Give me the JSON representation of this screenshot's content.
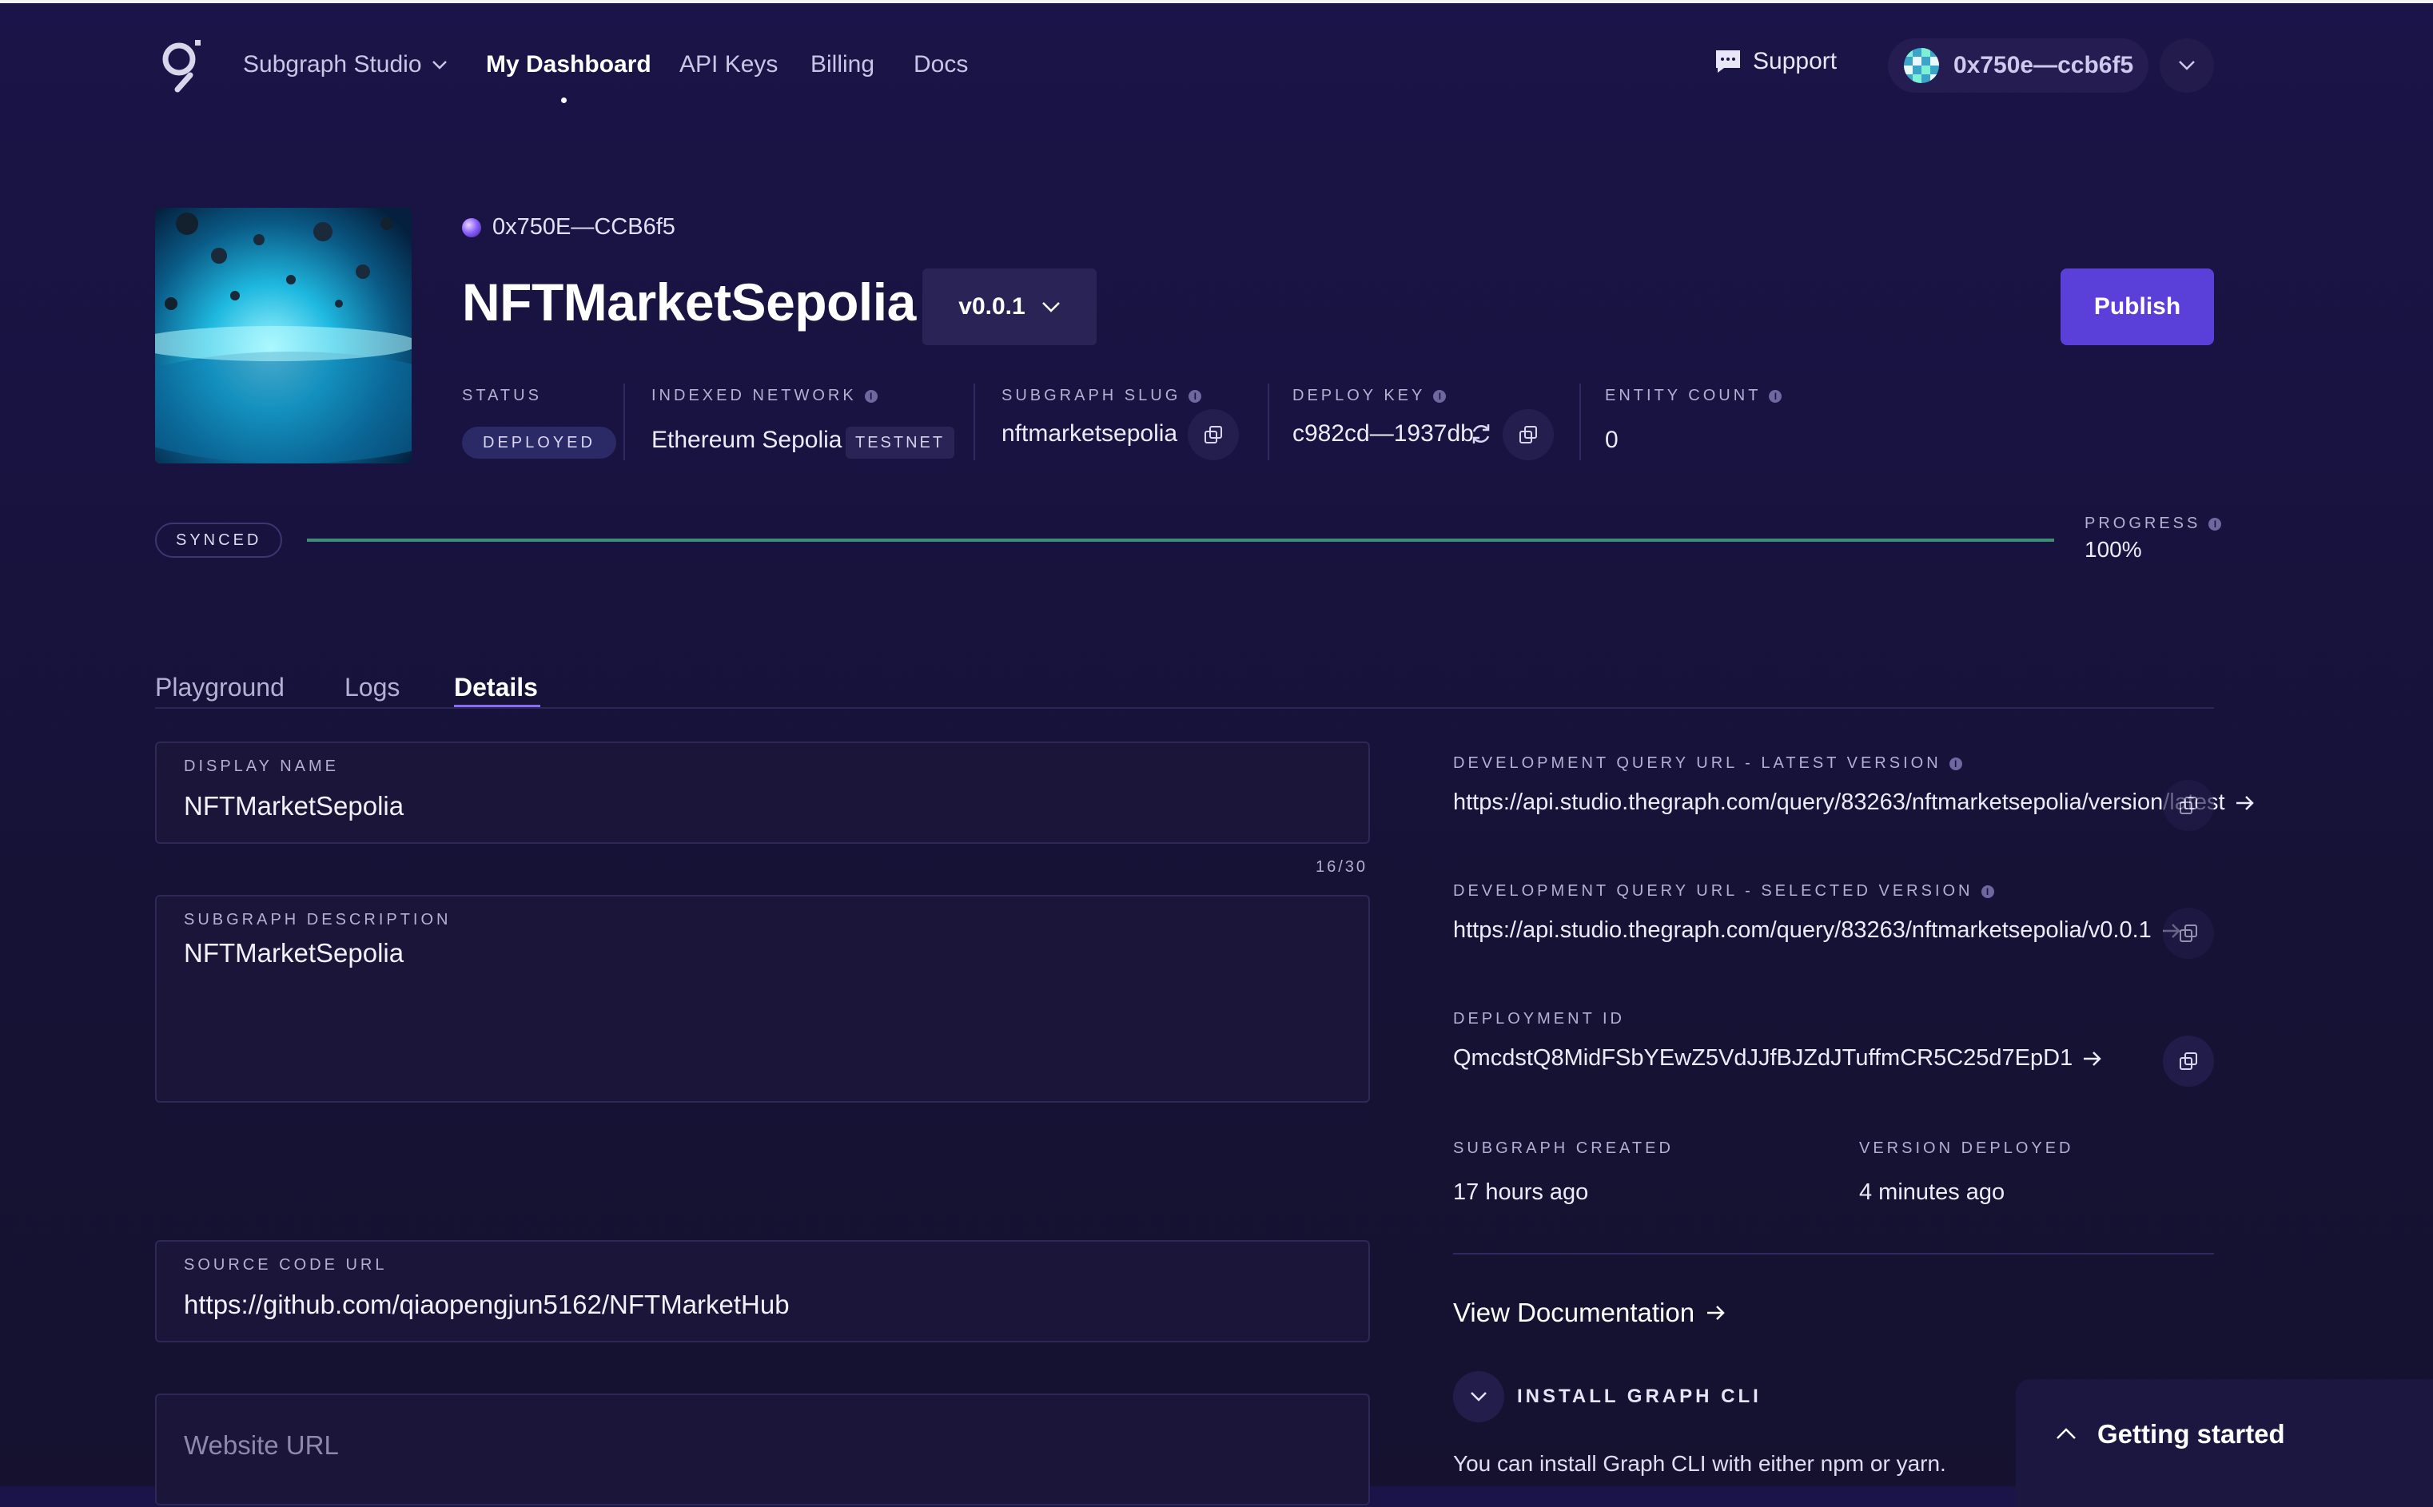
{
  "nav": {
    "app_name": "Subgraph Studio",
    "items": [
      "My Dashboard",
      "API Keys",
      "Billing",
      "Docs"
    ],
    "active": "My Dashboard",
    "support_label": "Support",
    "wallet_address": "0x750e—ccb6f5"
  },
  "subgraph": {
    "owner": "0x750E—CCB6f5",
    "title": "NFTMarketSepolia",
    "version": "v0.0.1",
    "publish_label": "Publish",
    "status_label": "STATUS",
    "status_value": "DEPLOYED",
    "network_label": "INDEXED NETWORK",
    "network_value": "Ethereum Sepolia",
    "network_badge": "TESTNET",
    "slug_label": "SUBGRAPH SLUG",
    "slug_value": "nftmarketsepolia",
    "deploy_key_label": "DEPLOY KEY",
    "deploy_key_value": "c982cd—1937db",
    "entity_count_label": "ENTITY COUNT",
    "entity_count_value": "0"
  },
  "sync": {
    "state": "SYNCED",
    "progress_label": "PROGRESS",
    "progress_text": "100%",
    "progress_fraction": 1.0
  },
  "tabs": [
    "Playground",
    "Logs",
    "Details"
  ],
  "active_tab": "Details",
  "form": {
    "display_name_label": "DISPLAY NAME",
    "display_name_value": "NFTMarketSepolia",
    "display_name_counter": "16/30",
    "description_label": "SUBGRAPH DESCRIPTION",
    "description_value": "NFTMarketSepolia",
    "source_label": "SOURCE CODE URL",
    "source_value": "https://github.com/qiaopengjun5162/NFTMarketHub",
    "website_placeholder": "Website URL"
  },
  "details": {
    "latest_url_label": "DEVELOPMENT QUERY URL - LATEST VERSION",
    "latest_url": "https://api.studio.thegraph.com/query/83263/nftmarketsepolia/version/latest",
    "selected_url_label": "DEVELOPMENT QUERY URL - SELECTED VERSION",
    "selected_url": "https://api.studio.thegraph.com/query/83263/nftmarketsepolia/v0.0.1",
    "deployment_id_label": "DEPLOYMENT ID",
    "deployment_id": "QmcdstQ8MidFSbYEwZ5VdJJfBJZdJTuffmCR5C25d7EpD1",
    "created_label": "SUBGRAPH CREATED",
    "created_value": "17 hours ago",
    "deployed_label": "VERSION DEPLOYED",
    "deployed_value": "4 minutes ago",
    "view_docs": "View Documentation",
    "cli_label": "INSTALL GRAPH CLI",
    "cli_desc": "You can install Graph CLI with either npm or yarn."
  },
  "getting_started": "Getting started",
  "icons": [
    "graph-logo-icon",
    "chevron-down-icon",
    "chat-bubble-icon",
    "wallet-avatar-icon",
    "info-icon",
    "copy-icon",
    "refresh-icon",
    "arrow-right-icon",
    "chevron-up-icon"
  ],
  "colors": {
    "accent": "#5a3fd9",
    "background": "#181340",
    "progress": "#3f8f78"
  }
}
